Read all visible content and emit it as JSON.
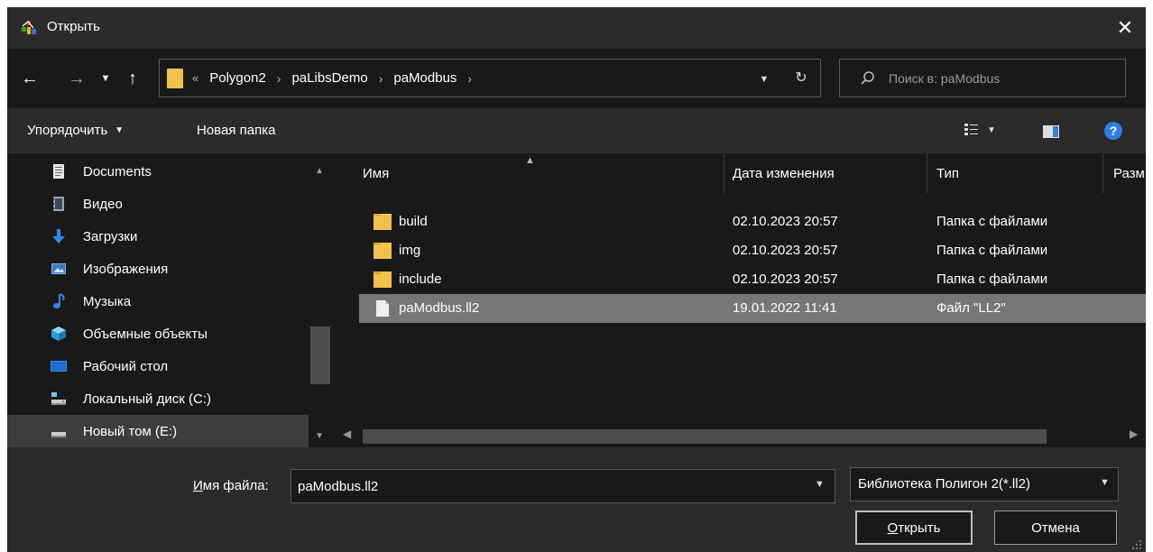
{
  "window": {
    "title": "Открыть",
    "close_glyph": "✕"
  },
  "nav": {
    "back_glyph": "←",
    "forward_glyph": "→",
    "recent_glyph": "⌄",
    "up_glyph": "↑"
  },
  "address": {
    "more_glyph": "«",
    "crumbs": [
      "Polygon2",
      "paLibsDemo",
      "paModbus"
    ],
    "separator": "›",
    "dropdown_glyph": "⌄",
    "refresh_glyph": "↻"
  },
  "search": {
    "placeholder": "Поиск в: paModbus"
  },
  "toolbar": {
    "organize_label": "Упорядочить",
    "new_folder_label": "Новая папка",
    "help_label": "?"
  },
  "sidebar": {
    "items": [
      {
        "label": "Documents",
        "icon": "document-icon"
      },
      {
        "label": "Видео",
        "icon": "video-icon"
      },
      {
        "label": "Загрузки",
        "icon": "download-icon"
      },
      {
        "label": "Изображения",
        "icon": "pictures-icon"
      },
      {
        "label": "Музыка",
        "icon": "music-icon"
      },
      {
        "label": "Объемные объекты",
        "icon": "3d-objects-icon"
      },
      {
        "label": "Рабочий стол",
        "icon": "desktop-icon"
      },
      {
        "label": "Локальный диск (C:)",
        "icon": "drive-icon"
      },
      {
        "label": "Новый том (E:)",
        "icon": "drive-icon"
      }
    ]
  },
  "filelist": {
    "columns": [
      "Имя",
      "Дата изменения",
      "Тип",
      "Разм"
    ],
    "rows": [
      {
        "name": "build",
        "date": "02.10.2023 20:57",
        "type": "Папка с файлами",
        "icon": "folder-icon"
      },
      {
        "name": "img",
        "date": "02.10.2023 20:57",
        "type": "Папка с файлами",
        "icon": "folder-icon"
      },
      {
        "name": "include",
        "date": "02.10.2023 20:57",
        "type": "Папка с файлами",
        "icon": "folder-icon"
      },
      {
        "name": "paModbus.ll2",
        "date": "19.01.2022 11:41",
        "type": "Файл \"LL2\"",
        "icon": "file-icon"
      }
    ]
  },
  "footer": {
    "filename_label_accel": "И",
    "filename_label_rest": "мя файла:",
    "filename_value": "paModbus.ll2",
    "filetype_value": "Библиотека Полигон 2(*.ll2)",
    "open_accel": "О",
    "open_rest": "ткрыть",
    "cancel_label": "Отмена"
  },
  "colors": {
    "background": "#2b2b2b",
    "pane": "#191919",
    "selection": "#777777",
    "folder": "#f2c14d",
    "accent": "#2d7fe0"
  }
}
